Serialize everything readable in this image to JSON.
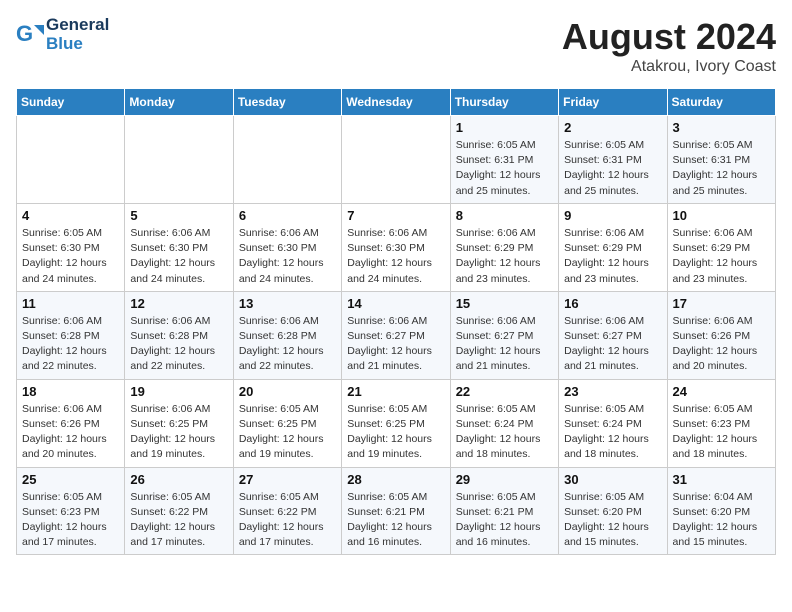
{
  "header": {
    "logo_line1": "General",
    "logo_line2": "Blue",
    "title": "August 2024",
    "subtitle": "Atakrou, Ivory Coast"
  },
  "days_of_week": [
    "Sunday",
    "Monday",
    "Tuesday",
    "Wednesday",
    "Thursday",
    "Friday",
    "Saturday"
  ],
  "weeks": [
    [
      {
        "day": "",
        "info": ""
      },
      {
        "day": "",
        "info": ""
      },
      {
        "day": "",
        "info": ""
      },
      {
        "day": "",
        "info": ""
      },
      {
        "day": "1",
        "info": "Sunrise: 6:05 AM\nSunset: 6:31 PM\nDaylight: 12 hours\nand 25 minutes."
      },
      {
        "day": "2",
        "info": "Sunrise: 6:05 AM\nSunset: 6:31 PM\nDaylight: 12 hours\nand 25 minutes."
      },
      {
        "day": "3",
        "info": "Sunrise: 6:05 AM\nSunset: 6:31 PM\nDaylight: 12 hours\nand 25 minutes."
      }
    ],
    [
      {
        "day": "4",
        "info": "Sunrise: 6:05 AM\nSunset: 6:30 PM\nDaylight: 12 hours\nand 24 minutes."
      },
      {
        "day": "5",
        "info": "Sunrise: 6:06 AM\nSunset: 6:30 PM\nDaylight: 12 hours\nand 24 minutes."
      },
      {
        "day": "6",
        "info": "Sunrise: 6:06 AM\nSunset: 6:30 PM\nDaylight: 12 hours\nand 24 minutes."
      },
      {
        "day": "7",
        "info": "Sunrise: 6:06 AM\nSunset: 6:30 PM\nDaylight: 12 hours\nand 24 minutes."
      },
      {
        "day": "8",
        "info": "Sunrise: 6:06 AM\nSunset: 6:29 PM\nDaylight: 12 hours\nand 23 minutes."
      },
      {
        "day": "9",
        "info": "Sunrise: 6:06 AM\nSunset: 6:29 PM\nDaylight: 12 hours\nand 23 minutes."
      },
      {
        "day": "10",
        "info": "Sunrise: 6:06 AM\nSunset: 6:29 PM\nDaylight: 12 hours\nand 23 minutes."
      }
    ],
    [
      {
        "day": "11",
        "info": "Sunrise: 6:06 AM\nSunset: 6:28 PM\nDaylight: 12 hours\nand 22 minutes."
      },
      {
        "day": "12",
        "info": "Sunrise: 6:06 AM\nSunset: 6:28 PM\nDaylight: 12 hours\nand 22 minutes."
      },
      {
        "day": "13",
        "info": "Sunrise: 6:06 AM\nSunset: 6:28 PM\nDaylight: 12 hours\nand 22 minutes."
      },
      {
        "day": "14",
        "info": "Sunrise: 6:06 AM\nSunset: 6:27 PM\nDaylight: 12 hours\nand 21 minutes."
      },
      {
        "day": "15",
        "info": "Sunrise: 6:06 AM\nSunset: 6:27 PM\nDaylight: 12 hours\nand 21 minutes."
      },
      {
        "day": "16",
        "info": "Sunrise: 6:06 AM\nSunset: 6:27 PM\nDaylight: 12 hours\nand 21 minutes."
      },
      {
        "day": "17",
        "info": "Sunrise: 6:06 AM\nSunset: 6:26 PM\nDaylight: 12 hours\nand 20 minutes."
      }
    ],
    [
      {
        "day": "18",
        "info": "Sunrise: 6:06 AM\nSunset: 6:26 PM\nDaylight: 12 hours\nand 20 minutes."
      },
      {
        "day": "19",
        "info": "Sunrise: 6:06 AM\nSunset: 6:25 PM\nDaylight: 12 hours\nand 19 minutes."
      },
      {
        "day": "20",
        "info": "Sunrise: 6:05 AM\nSunset: 6:25 PM\nDaylight: 12 hours\nand 19 minutes."
      },
      {
        "day": "21",
        "info": "Sunrise: 6:05 AM\nSunset: 6:25 PM\nDaylight: 12 hours\nand 19 minutes."
      },
      {
        "day": "22",
        "info": "Sunrise: 6:05 AM\nSunset: 6:24 PM\nDaylight: 12 hours\nand 18 minutes."
      },
      {
        "day": "23",
        "info": "Sunrise: 6:05 AM\nSunset: 6:24 PM\nDaylight: 12 hours\nand 18 minutes."
      },
      {
        "day": "24",
        "info": "Sunrise: 6:05 AM\nSunset: 6:23 PM\nDaylight: 12 hours\nand 18 minutes."
      }
    ],
    [
      {
        "day": "25",
        "info": "Sunrise: 6:05 AM\nSunset: 6:23 PM\nDaylight: 12 hours\nand 17 minutes."
      },
      {
        "day": "26",
        "info": "Sunrise: 6:05 AM\nSunset: 6:22 PM\nDaylight: 12 hours\nand 17 minutes."
      },
      {
        "day": "27",
        "info": "Sunrise: 6:05 AM\nSunset: 6:22 PM\nDaylight: 12 hours\nand 17 minutes."
      },
      {
        "day": "28",
        "info": "Sunrise: 6:05 AM\nSunset: 6:21 PM\nDaylight: 12 hours\nand 16 minutes."
      },
      {
        "day": "29",
        "info": "Sunrise: 6:05 AM\nSunset: 6:21 PM\nDaylight: 12 hours\nand 16 minutes."
      },
      {
        "day": "30",
        "info": "Sunrise: 6:05 AM\nSunset: 6:20 PM\nDaylight: 12 hours\nand 15 minutes."
      },
      {
        "day": "31",
        "info": "Sunrise: 6:04 AM\nSunset: 6:20 PM\nDaylight: 12 hours\nand 15 minutes."
      }
    ]
  ]
}
